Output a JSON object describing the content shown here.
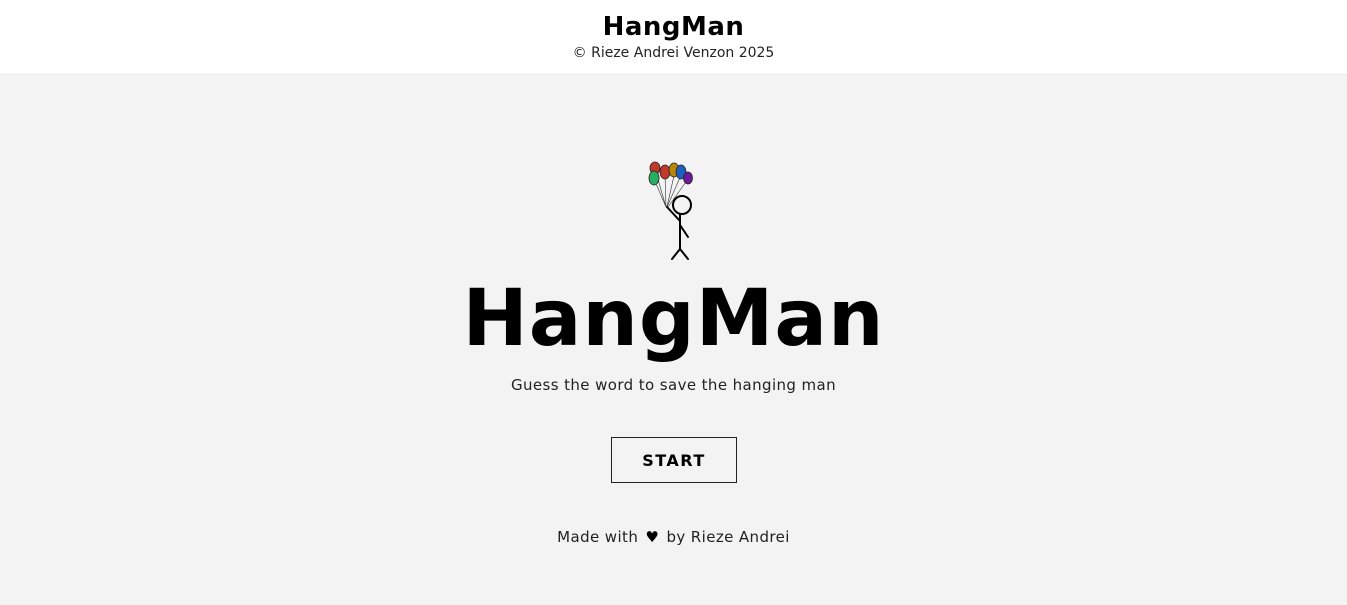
{
  "header": {
    "title": "HangMan",
    "copyright": "© Rieze Andrei Venzon 2025"
  },
  "hero": {
    "illustration": "stickman-with-balloons-icon",
    "balloon_colors": [
      "#c0392b",
      "#27ae60",
      "#c0392b",
      "#b8860b",
      "#1f5fbf",
      "#6a1b9a"
    ],
    "title": "HangMan",
    "tagline": "Guess the word to save the hanging man",
    "start_label": "START"
  },
  "footer": {
    "made_with_prefix": "Made with",
    "heart_icon": "heart-icon",
    "heart_glyph": "♥",
    "made_with_suffix": "by Rieze Andrei"
  }
}
